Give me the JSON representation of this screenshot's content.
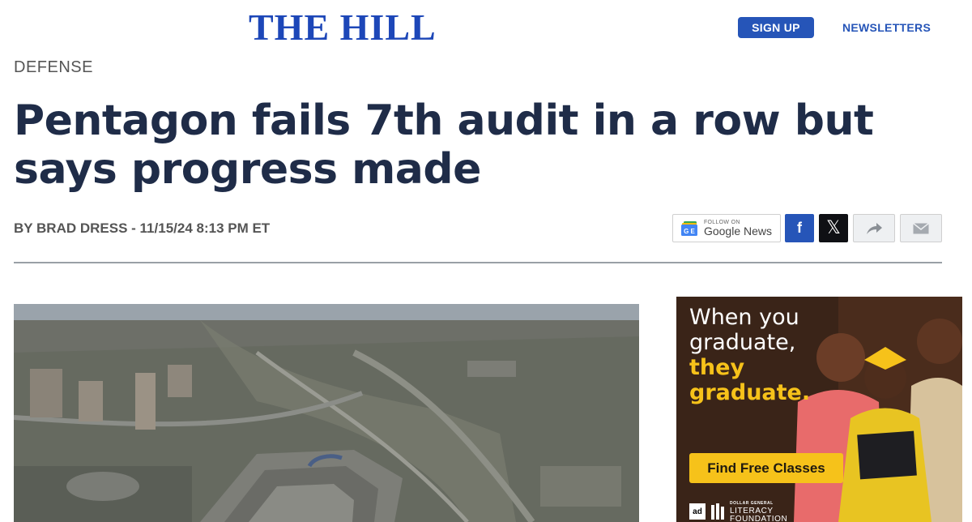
{
  "header": {
    "logo": "THE HILL",
    "signup_label": "SIGN UP",
    "newsletters_label": "NEWSLETTERS"
  },
  "article": {
    "section": "DEFENSE",
    "headline": "Pentagon fails 7th audit in a row but says progress made",
    "byline": "BY BRAD DRESS - 11/15/24 8:13 PM ET"
  },
  "share": {
    "google_follow": "FOLLOW ON",
    "google_news": "Google News",
    "facebook_glyph": "f",
    "x_glyph": "𝕏",
    "icons": [
      "google-news-icon",
      "facebook-icon",
      "x-icon",
      "share-arrow-icon",
      "mail-icon"
    ]
  },
  "ad": {
    "line1": "When you",
    "line2": "graduate,",
    "line3": "they",
    "line4": "graduate.",
    "cta": "Find Free Classes",
    "ad_council": "ad",
    "sponsor_small": "DOLLAR GENERAL",
    "sponsor_line1": "LITERACY",
    "sponsor_line2": "FOUNDATION"
  },
  "colors": {
    "brand_blue": "#1d47b8",
    "button_blue": "#2655b8",
    "headline": "#1f2c48",
    "ad_yellow": "#f6c21a"
  }
}
